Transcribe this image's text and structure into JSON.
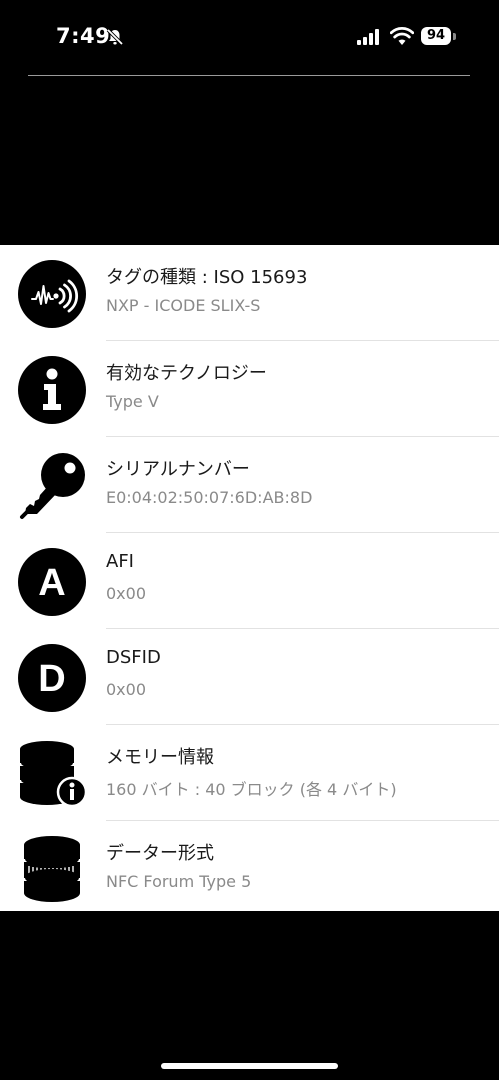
{
  "status_bar": {
    "time": "7:49",
    "battery": "94"
  },
  "rows": [
    {
      "title": "タグの種類 : ISO 15693",
      "value": "NXP - ICODE SLIX-S"
    },
    {
      "title": "有効なテクノロジー",
      "value": "Type V"
    },
    {
      "title": "シリアルナンバー",
      "value": "E0:04:02:50:07:6D:AB:8D"
    },
    {
      "title": "AFI",
      "value": "0x00",
      "icon_letter": "A"
    },
    {
      "title": "DSFID",
      "value": "0x00",
      "icon_letter": "D"
    },
    {
      "title": "メモリー情報",
      "value": "160 バイト : 40 ブロック (各 4 バイト)"
    },
    {
      "title": "データー形式",
      "value": "NFC Forum Type 5"
    }
  ]
}
